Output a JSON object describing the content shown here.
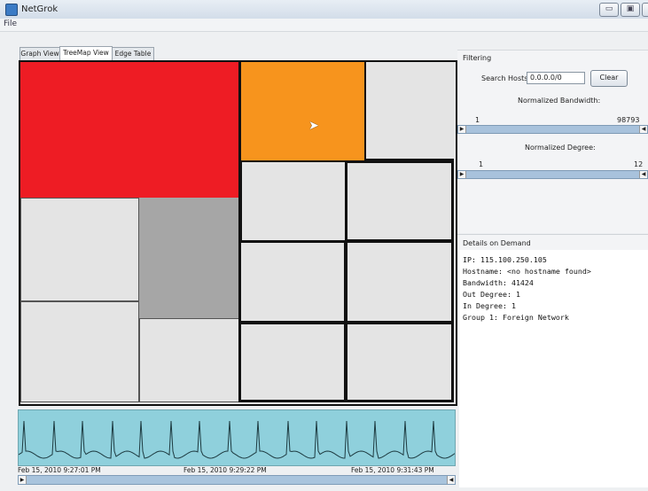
{
  "window": {
    "title": "NetGrok",
    "min_symbol": "▭",
    "max_symbol": "▣",
    "close_symbol": "⊠"
  },
  "menu": {
    "file": "File"
  },
  "tabs": [
    {
      "label": "Graph View",
      "active": false
    },
    {
      "label": "TreeMap View",
      "active": true
    },
    {
      "label": "Edge Table",
      "active": false
    }
  ],
  "treemap": {
    "colors": {
      "red": "#ee1c24",
      "orange": "#f7941d",
      "gray": "#a6a6a6",
      "default": "#e4e4e4"
    }
  },
  "timeline": {
    "labels": [
      "Feb 15, 2010 9:27:01 PM",
      "Feb 15, 2010 9:29:22 PM",
      "Feb 15, 2010 9:31:43 PM"
    ],
    "colors": {
      "background": "#8fd0dc",
      "line": "#1d3a40"
    }
  },
  "filtering": {
    "title": "Filtering",
    "search_label": "Search Hosts:",
    "search_value": "0.0.0.0/0",
    "clear_label": "Clear",
    "bandwidth": {
      "label": "Normalized Bandwidth:",
      "min": "1",
      "max": "98793"
    },
    "degree": {
      "label": "Normalized Degree:",
      "min": "1",
      "max": "12"
    }
  },
  "details": {
    "title": "Details on Demand",
    "lines": [
      "IP: 115.100.250.105",
      "Hostname: <no hostname found>",
      "Bandwidth: 41424",
      "Out Degree: 1",
      "In Degree: 1",
      "Group 1: Foreign Network"
    ]
  }
}
